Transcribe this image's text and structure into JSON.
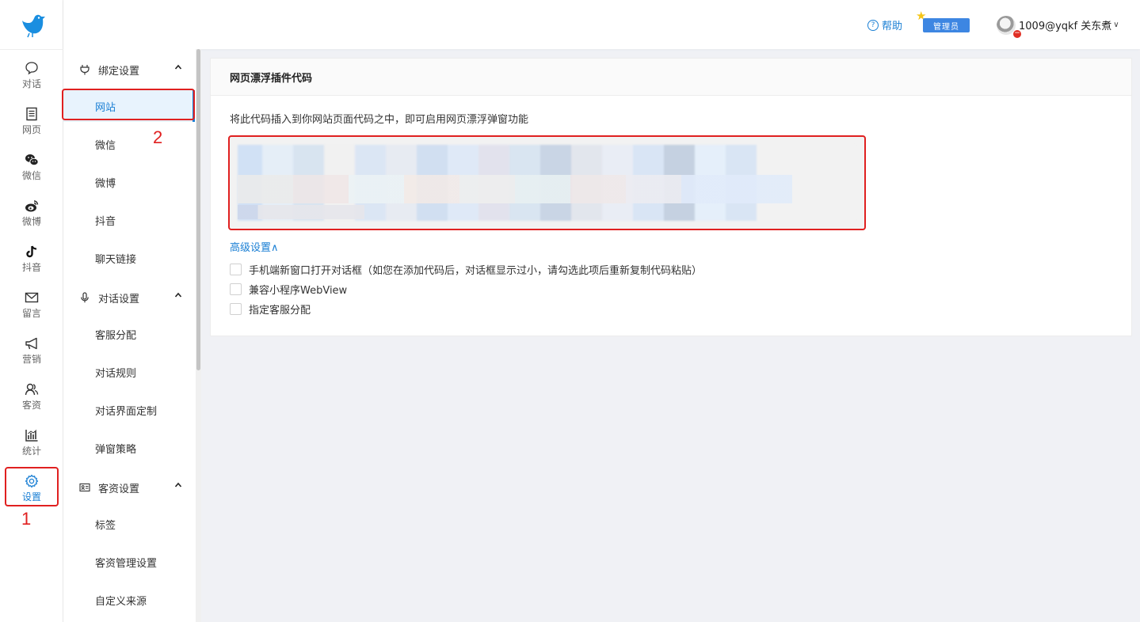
{
  "header": {
    "help_label": "帮助",
    "admin_badge": "管理员",
    "user_name": "1009@yqkf 关东煮"
  },
  "rail": {
    "items": [
      {
        "label": "对话",
        "icon": "chat-bubble-icon"
      },
      {
        "label": "网页",
        "icon": "webpage-icon"
      },
      {
        "label": "微信",
        "icon": "wechat-icon"
      },
      {
        "label": "微博",
        "icon": "weibo-icon"
      },
      {
        "label": "抖音",
        "icon": "douyin-icon"
      },
      {
        "label": "留言",
        "icon": "mail-icon"
      },
      {
        "label": "营销",
        "icon": "megaphone-icon"
      },
      {
        "label": "客资",
        "icon": "contacts-icon"
      },
      {
        "label": "统计",
        "icon": "stats-chart-icon"
      },
      {
        "label": "设置",
        "icon": "gear-icon",
        "active": true
      }
    ]
  },
  "submenu": {
    "groups": [
      {
        "label": "绑定设置",
        "icon": "plug-icon",
        "items": [
          "网站",
          "微信",
          "微博",
          "抖音",
          "聊天链接"
        ]
      },
      {
        "label": "对话设置",
        "icon": "microphone-icon",
        "items": [
          "客服分配",
          "对话规则",
          "对话界面定制",
          "弹窗策略"
        ]
      },
      {
        "label": "客资设置",
        "icon": "id-card-icon",
        "items": [
          "标签",
          "客资管理设置",
          "自定义来源"
        ]
      }
    ],
    "active_item": "网站"
  },
  "main": {
    "card_title": "网页漂浮插件代码",
    "description": "将此代码插入到你网站页面代码之中，即可启用网页漂浮弹窗功能",
    "advanced_label": "高级设置∧",
    "options": [
      {
        "label": "手机端新窗口打开对话框（如您在添加代码后，对话框显示过小，请勾选此项后重新复制代码粘贴）",
        "checked": false
      },
      {
        "label": "兼容小程序WebView",
        "checked": false
      },
      {
        "label": "指定客服分配",
        "checked": false
      }
    ]
  },
  "annotations": {
    "num1": "1",
    "num2": "2"
  },
  "colors": {
    "accent": "#1a7fd4",
    "annotation_red": "#e02020",
    "background": "#f0f1f5"
  }
}
